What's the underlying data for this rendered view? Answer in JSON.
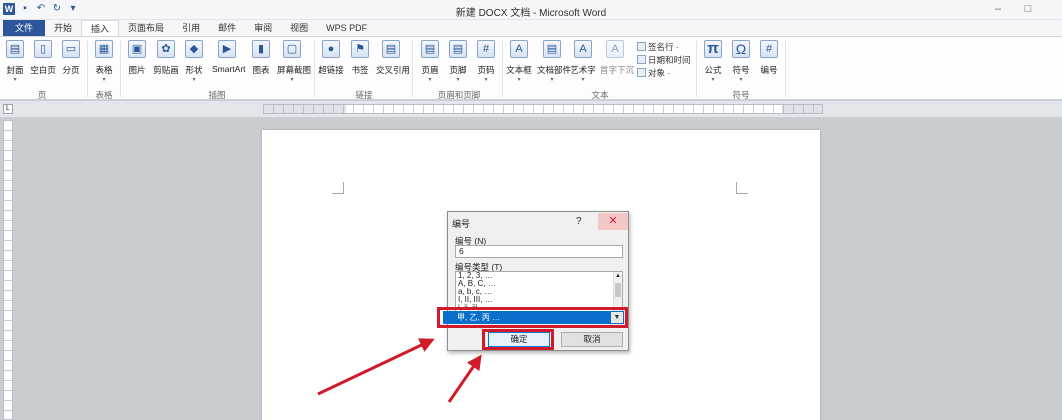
{
  "window": {
    "title": "新建 DOCX 文档 - Microsoft Word",
    "minimize": "–",
    "maximize": "□"
  },
  "tabs": [
    "文件",
    "开始",
    "插入",
    "页面布局",
    "引用",
    "邮件",
    "审阅",
    "视图",
    "WPS PDF"
  ],
  "ribbon": {
    "buttons": [
      {
        "label": "封面",
        "icon": "▤"
      },
      {
        "label": "空白页",
        "icon": "▯"
      },
      {
        "label": "分页",
        "icon": "▭"
      },
      {
        "label": "表格",
        "icon": "▦"
      },
      {
        "label": "图片",
        "icon": "▣"
      },
      {
        "label": "剪贴画",
        "icon": "✿"
      },
      {
        "label": "形状",
        "icon": "◆"
      },
      {
        "label": "SmartArt",
        "icon": "▶"
      },
      {
        "label": "图表",
        "icon": "▮"
      },
      {
        "label": "屏幕截图",
        "icon": "▢"
      },
      {
        "label": "超链接",
        "icon": "●"
      },
      {
        "label": "书签",
        "icon": "⚑"
      },
      {
        "label": "交叉引用",
        "icon": "▤"
      },
      {
        "label": "页眉",
        "icon": "▤"
      },
      {
        "label": "页脚",
        "icon": "▤"
      },
      {
        "label": "页码",
        "icon": "#"
      },
      {
        "label": "文本框",
        "icon": "A"
      },
      {
        "label": "文档部件",
        "icon": "▤"
      },
      {
        "label": "艺术字",
        "icon": "A"
      },
      {
        "label": "首字下沉",
        "icon": "A"
      },
      {
        "label": "公式",
        "icon": "π"
      },
      {
        "label": "符号",
        "icon": "Ω"
      },
      {
        "label": "编号",
        "icon": "#"
      }
    ],
    "small_items": [
      "签名行 ·",
      "日期和时间",
      "对象 ·"
    ],
    "groups": [
      "页",
      "表格",
      "插图",
      "链接",
      "页眉和页脚",
      "文本",
      "符号"
    ]
  },
  "ruler": {
    "corner": "L"
  },
  "dialog": {
    "title": "编号",
    "help": "?",
    "close": "✕",
    "number_label": "编号 (N)",
    "number_value": "6",
    "type_label": "编号类型 (T)",
    "list_items": [
      "1, 2, 3, …",
      "A, B, C, …",
      "a, b, c, …",
      "I, II, III, …",
      "i, ii, iii, …"
    ],
    "selected_item": "甲, 乙, 丙 …",
    "ok_label": "确定",
    "cancel_label": "取消"
  },
  "colors": {
    "accent": "#2b579a",
    "highlight": "#d11b2a",
    "selection": "#0a6ecb",
    "close": "#e81123"
  }
}
